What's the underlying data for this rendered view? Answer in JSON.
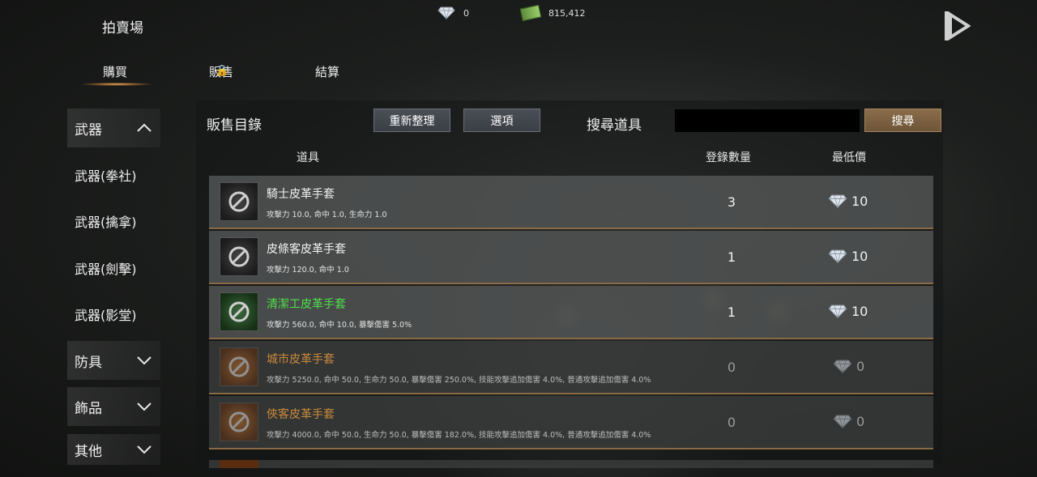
{
  "header": {
    "title": "拍賣場",
    "diamond_amount": "0",
    "money_amount": "815,412"
  },
  "tabs": [
    {
      "label": "購買",
      "active": true
    },
    {
      "label": "販售",
      "locked": true
    },
    {
      "label": "結算"
    }
  ],
  "sidebar": {
    "categories": [
      {
        "label": "武器",
        "expanded": true,
        "sub": [
          "武器(拳社)",
          "武器(擒拿)",
          "武器(劍擊)",
          "武器(影堂)"
        ]
      },
      {
        "label": "防具",
        "expanded": false
      },
      {
        "label": "飾品",
        "expanded": false
      },
      {
        "label": "其他",
        "expanded": false
      }
    ]
  },
  "panel": {
    "title": "販售目錄",
    "refresh_label": "重新整理",
    "options_label": "選項",
    "search_label": "搜尋道具",
    "search_value": "",
    "search_button": "搜尋",
    "col_item": "道具",
    "col_count": "登錄數量",
    "col_price": "最低價"
  },
  "items": [
    {
      "name": "騎士皮革手套",
      "stats": "攻擊力 10.0, 命中 1.0, 生命力 1.0",
      "count": "3",
      "price": "10",
      "grade": "grey"
    },
    {
      "name": "皮條客皮革手套",
      "stats": "攻擊力 120.0, 命中 1.0",
      "count": "1",
      "price": "10",
      "grade": "grey"
    },
    {
      "name": "清潔工皮革手套",
      "stats": "攻擊力 560.0, 命中 10.0, 暴擊傷害 5.0%",
      "count": "1",
      "price": "10",
      "grade": "green"
    },
    {
      "name": "城市皮革手套",
      "stats": "攻擊力 5250.0, 命中 50.0, 生命力 50.0, 暴擊傷害 250.0%, 技能攻擊追加傷害 4.0%, 普通攻擊追加傷害 4.0%",
      "count": "0",
      "price": "0",
      "grade": "orange"
    },
    {
      "name": "俠客皮革手套",
      "stats": "攻擊力 4000.0, 命中 50.0, 生命力 50.0, 暴擊傷害 182.0%, 技能攻擊追加傷害 4.0%, 普通攻擊追加傷害 4.0%",
      "count": "0",
      "price": "0",
      "grade": "orange"
    }
  ],
  "colors": {
    "green_grade": "#4fe04a",
    "orange_grade": "#c98a3a",
    "row_border": "#8a6a45"
  }
}
